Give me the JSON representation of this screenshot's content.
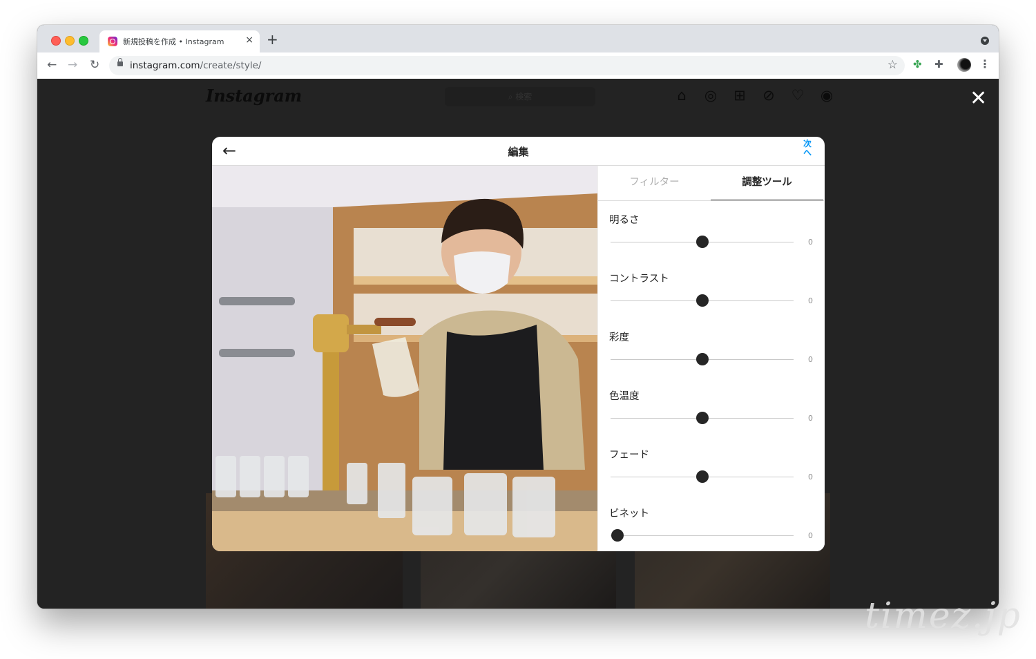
{
  "browser": {
    "tab_title": "新規投稿を作成 • Instagram",
    "tab_close": "×",
    "new_tab": "+",
    "back": "←",
    "forward": "→",
    "reload": "↻",
    "url_host": "instagram.com",
    "url_path": "/create/style/",
    "star": "☆",
    "ext_clover": "✤",
    "ext_puzzle": "✚",
    "menu": "⋮"
  },
  "instagram": {
    "logo": "Instagram",
    "search_placeholder": "⌕ 検索",
    "nav": [
      "⌂",
      "◎",
      "⊞",
      "⊘",
      "♡",
      "◉"
    ],
    "close": "✕"
  },
  "modal": {
    "back": "←",
    "title": "編集",
    "next": "次へ"
  },
  "panel": {
    "tabs": [
      "フィルター",
      "調整ツール"
    ],
    "active_tab": 1,
    "adjustments": [
      {
        "label": "明るさ",
        "value": "0",
        "position": 0.5
      },
      {
        "label": "コントラスト",
        "value": "0",
        "position": 0.5
      },
      {
        "label": "彩度",
        "value": "0",
        "position": 0.5
      },
      {
        "label": "色温度",
        "value": "0",
        "position": 0.5
      },
      {
        "label": "フェード",
        "value": "0",
        "position": 0.5
      },
      {
        "label": "ビネット",
        "value": "0",
        "position": 0.0
      }
    ]
  },
  "watermark": "timez.jp"
}
